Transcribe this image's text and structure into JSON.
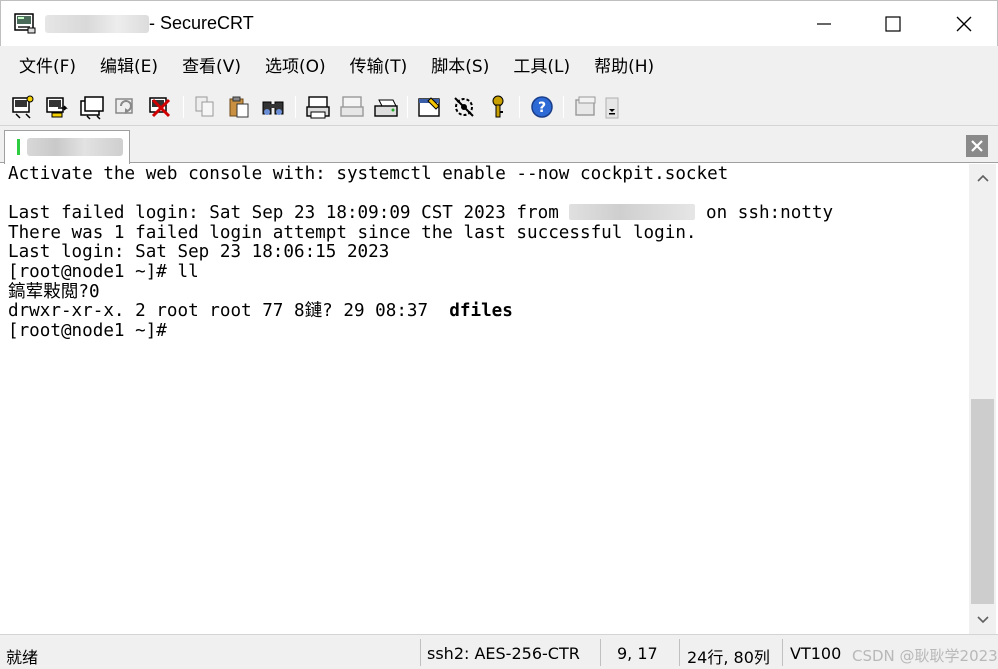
{
  "window": {
    "title_suffix": "- SecureCRT",
    "controls": [
      "minimize-icon",
      "maximize-icon",
      "close-icon"
    ]
  },
  "menu": [
    {
      "label": "文件(F)"
    },
    {
      "label": "编辑(E)"
    },
    {
      "label": "查看(V)"
    },
    {
      "label": "选项(O)"
    },
    {
      "label": "传输(T)"
    },
    {
      "label": "脚本(S)"
    },
    {
      "label": "工具(L)"
    },
    {
      "label": "帮助(H)"
    }
  ],
  "toolbar": {
    "icons": [
      "connect-icon",
      "quick-connect-icon",
      "connect-in-tab-icon",
      "reconnect-icon",
      "disconnect-icon",
      "copy-icon",
      "paste-icon",
      "find-icon",
      "print-icon",
      "print-selection-icon",
      "print-setup-icon",
      "session-options-icon",
      "global-options-icon",
      "keymap-icon",
      "help-icon",
      "sftp-icon",
      "toolbar-dropdown-icon"
    ]
  },
  "terminal": {
    "lines": [
      "Activate the web console with: systemctl enable --now cockpit.socket",
      "",
      "Last failed login: Sat Sep 23 18:09:09 CST 2023 from ",
      "There was 1 failed login attempt since the last successful login.",
      "Last login: Sat Sep 23 18:06:15 2023",
      "[root@node1 ~]# ll",
      "鎬荤敤閲?0",
      "drwxr-xr-x. 2 root root 77 8鏈? 29 08:37  ",
      "[root@node1 ~]#"
    ],
    "line3_tail": " on ssh:notty",
    "dir_name": "dfiles"
  },
  "status": {
    "ready": "就绪",
    "cipher": "ssh2: AES-256-CTR",
    "cursor": "9,  17",
    "size": "24行, 80列",
    "emulation": "VT100",
    "watermark": "CSDN @耿耿学2023"
  }
}
